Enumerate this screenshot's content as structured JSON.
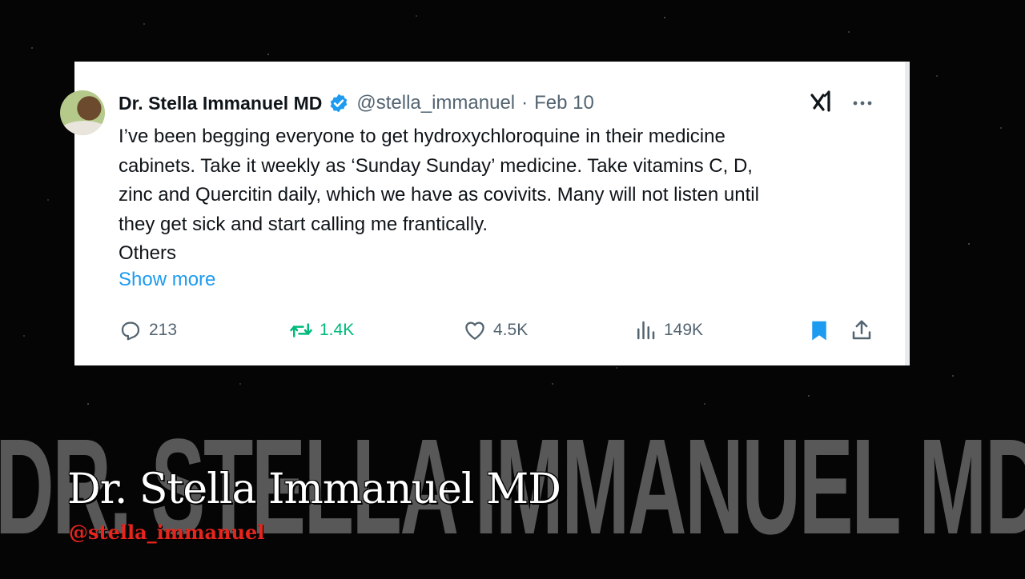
{
  "watermark": {
    "text": "DR. STELLA IMMANUEL MD"
  },
  "tweet": {
    "author_name": "Dr. Stella Immanuel MD",
    "handle": "@stella_immanuel",
    "separator": "·",
    "date": "Feb 10",
    "lines": [
      "I’ve been begging everyone to get hydroxychloroquine in their medicine",
      "cabinets. Take it weekly as ‘Sunday Sunday’ medicine. Take vitamins C, D,",
      "zinc and Quercitin daily, which we have as covivits. Many will not listen until",
      "they get sick and start calling me frantically.",
      "Others"
    ],
    "show_more": "Show more",
    "actions": {
      "replies": "213",
      "reposts": "1.4K",
      "likes": "4.5K",
      "views": "149K"
    },
    "icons": {
      "verified": "verified-badge-icon",
      "grok": "grok-icon",
      "more": "more-icon",
      "reply": "reply-icon",
      "repost": "repost-icon",
      "like": "heart-icon",
      "views": "views-icon",
      "bookmark": "bookmark-icon",
      "share": "share-icon"
    },
    "colors": {
      "link": "#1d9bf0",
      "repost_active": "#00ba7c",
      "bookmark_active": "#1d9bf0",
      "muted": "#536471"
    }
  },
  "lower_third": {
    "name": "Dr. Stella Immanuel MD",
    "handle": "@stella_immanuel",
    "handle_color": "#e8251d"
  }
}
